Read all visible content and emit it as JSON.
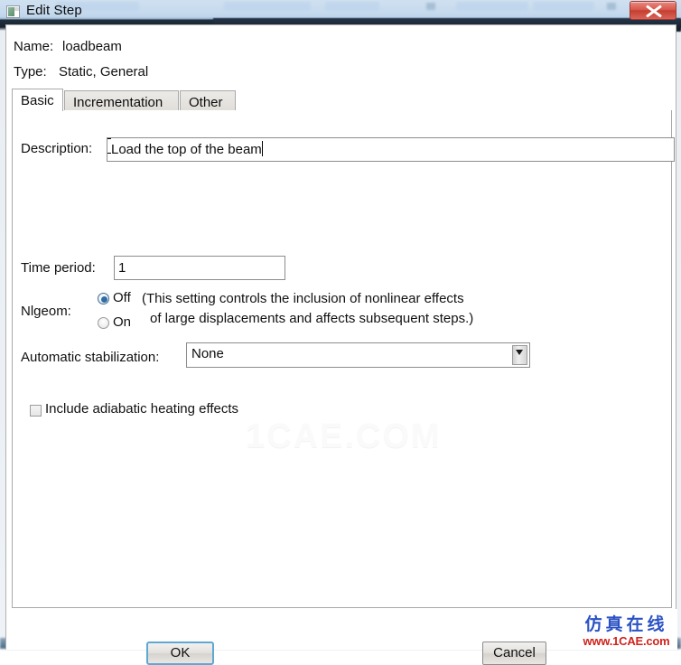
{
  "window": {
    "title": "Edit Step",
    "icon": "step-icon",
    "close_label": "close-icon"
  },
  "header": {
    "name_label": "Name:",
    "name_value": "loadbeam",
    "type_label": "Type:",
    "type_value": "Static, General"
  },
  "tabs": [
    {
      "label": "Basic",
      "active": true
    },
    {
      "label": "Incrementation",
      "active": false
    },
    {
      "label": "Other",
      "active": false
    }
  ],
  "basic": {
    "description_label": "Description:",
    "description_value": "Load the top of the beam",
    "time_period_label": "Time period:",
    "time_period_value": "1",
    "nlgeom_label": "Nlgeom:",
    "nlgeom_options": [
      {
        "label": "Off",
        "selected": true
      },
      {
        "label": "On",
        "selected": false
      }
    ],
    "nlgeom_hint_line1": "(This setting controls the inclusion of nonlinear effects",
    "nlgeom_hint_line2": "of large displacements and affects subsequent steps.)",
    "stabilization_label": "Automatic stabilization:",
    "stabilization_value": "None",
    "stabilization_options": [
      "None"
    ],
    "adiabatic_label": "Include adiabatic heating effects",
    "adiabatic_checked": false
  },
  "footer": {
    "ok_label": "OK",
    "cancel_label": "Cancel"
  },
  "watermark": {
    "center_text": "1CAE.COM",
    "logo_cn": "仿真在线",
    "logo_url": "www.1CAE.com"
  },
  "colors": {
    "accent": "#2f6ea5",
    "focus_border": "#5fa8d3",
    "close_red": "#c4402f",
    "logo_blue": "#2b52c4",
    "logo_red": "#d0231c"
  }
}
